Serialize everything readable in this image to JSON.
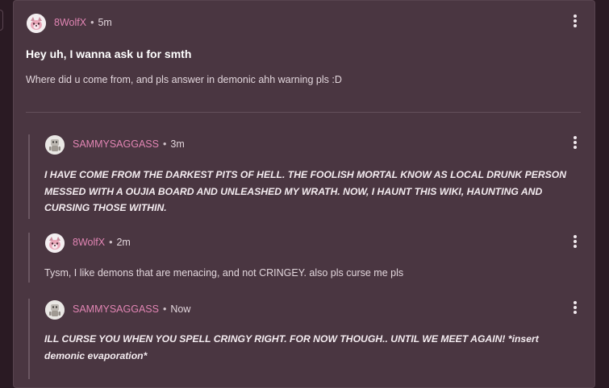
{
  "post": {
    "author": "8WolfX",
    "time": "5m",
    "separator": "•",
    "title": "Hey uh, I wanna ask u for smth",
    "body": "Where did u come from, and pls answer in demonic ahh warning pls :D"
  },
  "replies": [
    {
      "author": "SAMMYSAGGASS",
      "time": "3m",
      "text": "I HAVE COME FROM THE DARKEST PITS OF HELL. THE FOOLISH MORTAL KNOW AS LOCAL DRUNK PERSON MESSED WITH A OUJIA BOARD AND UNLEASHED MY WRATH. NOW, I HAUNT THIS WIKI, HAUNTING AND CURSING THOSE WITHIN."
    },
    {
      "author": "8WolfX",
      "time": "2m",
      "text": "Tysm, I like demons that are menacing, and not CRINGEY. also pls curse me pls"
    },
    {
      "author": "SAMMYSAGGASS",
      "time": "Now",
      "text": "ILL CURSE YOU WHEN YOU SPELL CRINGY RIGHT.  FOR NOW THOUGH.. UNTIL WE MEET AGAIN! *insert demonic evaporation*"
    }
  ],
  "colors": {
    "background": "#2a1a23",
    "card": "#4a3641",
    "username": "#e285b4",
    "text": "#e2d6dc"
  },
  "icons": {
    "avatar_wolf": "wolf-avatar-icon",
    "avatar_sammy": "robot-avatar-icon",
    "menu": "more-vertical-icon"
  }
}
